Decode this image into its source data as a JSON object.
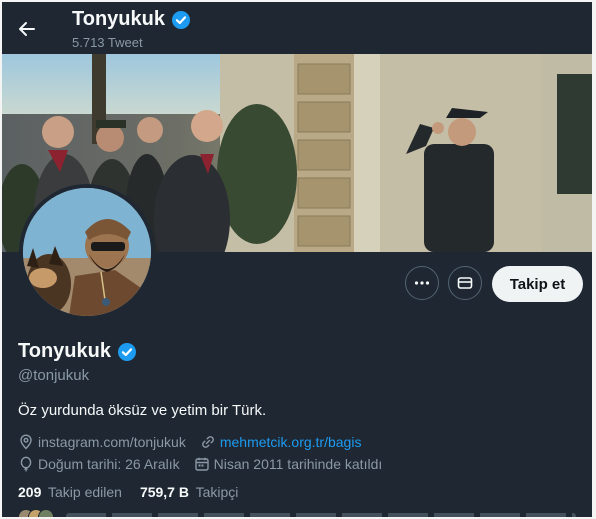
{
  "header": {
    "name": "Tonyukuk",
    "tweet_count": "5.713 Tweet"
  },
  "profile": {
    "name": "Tonyukuk",
    "handle": "@tonjukuk",
    "bio": "Öz yurdunda öksüz ve yetim bir Türk.",
    "instagram": "instagram.com/tonjukuk",
    "website": "mehmetcik.org.tr/bagis",
    "birthday": "Doğum tarihi: 26 Aralık",
    "joined": "Nisan 2011 tarihinde katıldı",
    "following_count": "209",
    "following_label": "Takip edilen",
    "followers_count": "759,7 B",
    "followers_label": "Takipçi"
  },
  "actions": {
    "follow_label": "Takip et"
  },
  "colors": {
    "background": "#1e2732",
    "accent": "#1d9bf0",
    "muted_text": "#8b98a5",
    "follow_button_bg": "#eff3f4"
  },
  "icons": [
    "back-arrow-icon",
    "verified-badge-icon",
    "more-icon",
    "message-icon",
    "location-icon",
    "link-icon",
    "balloon-icon",
    "calendar-icon"
  ]
}
